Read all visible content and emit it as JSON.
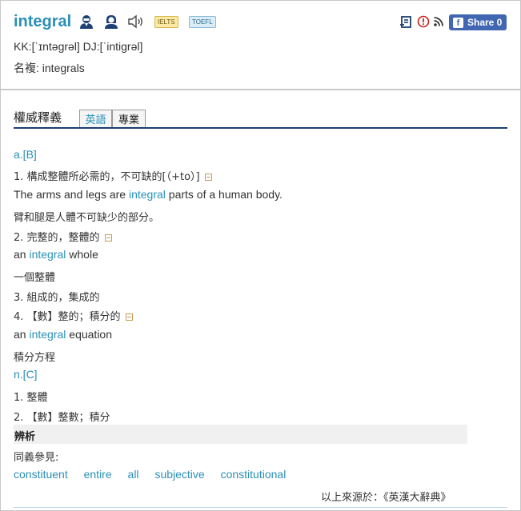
{
  "header": {
    "word": "integral",
    "badges": {
      "ielts": "IELTS",
      "toefl": "TOEFL"
    },
    "phonetic": "KK:[ˈɪntəgrəl] DJ:[ˈintigrəl]",
    "plural": "名複: integrals",
    "share_label": "Share 0",
    "icons": [
      "male-voice-icon",
      "female-voice-icon",
      "speaker-icon",
      "wordbook-add-icon",
      "report-icon",
      "rss-icon",
      "facebook-icon"
    ],
    "colors": {
      "accent": "#2a90b6",
      "facebook": "#4267b2",
      "rss": "#333333",
      "report": "#cc2222"
    }
  },
  "section": {
    "title": "權威釋義",
    "tabs": [
      {
        "label": "英語",
        "active": true
      },
      {
        "label": "專業",
        "active": false
      }
    ]
  },
  "entries": {
    "adj_pos": "a.[B]",
    "def1": "1. 構成整體所必需的，不可缺的[（+to）]",
    "ex1_pre": "The arms and legs are ",
    "ex1_hl": "integral",
    "ex1_post": " parts of a human body.",
    "ex1_tr": "臂和腿是人體不可缺少的部分。",
    "def2": "2. 完整的，整體的",
    "ex2_pre": "an ",
    "ex2_hl": "integral",
    "ex2_post": " whole",
    "ex2_tr": "一個整體",
    "def3": "3. 組成的，集成的",
    "def4": "4. 【數】整的；積分的",
    "ex4_pre": "an ",
    "ex4_hl": "integral",
    "ex4_post": " equation",
    "ex4_tr": "積分方程",
    "noun_pos": "n.[C]",
    "ndef1": "1. 整體",
    "ndef2": "2. 【數】整數；積分"
  },
  "analysis": {
    "title": "辨析",
    "see_also": "同義參見:",
    "synonyms": [
      "constituent",
      "entire",
      "all",
      "subjective",
      "constitutional"
    ],
    "source": "以上來源於：《英漢大辭典》"
  }
}
